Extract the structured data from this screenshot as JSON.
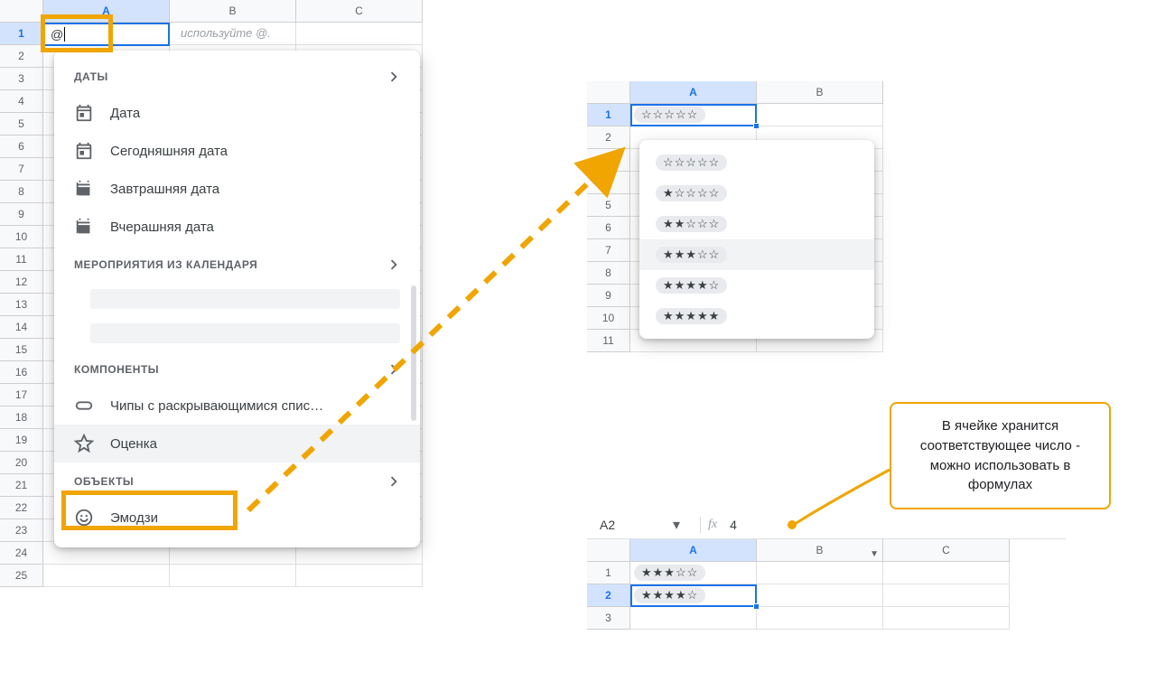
{
  "sheet1": {
    "cols": [
      "A",
      "B",
      "C"
    ],
    "sel_col": 0,
    "rows": 25,
    "editing_value": "@",
    "hint": "используйте @."
  },
  "menu": {
    "sec_dates": "ДАТЫ",
    "date": "Дата",
    "today": "Сегодняшняя дата",
    "tomorrow": "Завтрашняя дата",
    "yesterday": "Вчерашняя дата",
    "sec_calendar": "МЕРОПРИЯТИЯ ИЗ КАЛЕНДАРЯ",
    "sec_components": "КОМПОНЕНТЫ",
    "chips": "Чипы с раскрывающимися спис…",
    "rating": "Оценка",
    "sec_objects": "ОБЪЕКТЫ",
    "emoji": "Эмодзи"
  },
  "sheet2": {
    "cols": [
      "A",
      "B"
    ],
    "rows": 11,
    "cell_value": "☆☆☆☆☆",
    "options": [
      "☆☆☆☆☆",
      "★☆☆☆☆",
      "★★☆☆☆",
      "★★★☆☆",
      "★★★★☆",
      "★★★★★"
    ],
    "sel_index": 3
  },
  "bar3": {
    "cell_ref": "A2",
    "fx_label": "fx",
    "value": "4"
  },
  "sheet3": {
    "cols": [
      "A",
      "B",
      "C"
    ],
    "rows": 3,
    "a1": "★★★☆☆",
    "a2": "★★★★☆"
  },
  "callout": "В ячейке хранится соответствующее число - можно использовать в формулах"
}
